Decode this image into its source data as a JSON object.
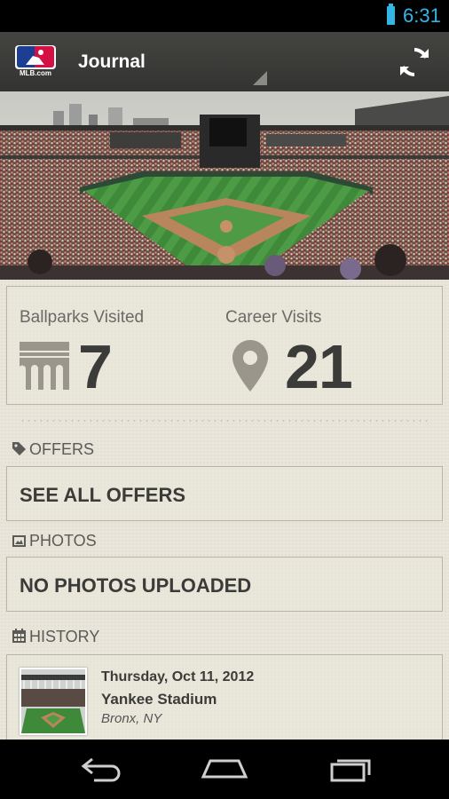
{
  "status_bar": {
    "time": "6:31"
  },
  "action_bar": {
    "logo_text": "MLB.com",
    "title": "Journal",
    "refresh_icon": "refresh-icon"
  },
  "stats": {
    "ballparks_label": "Ballparks Visited",
    "ballparks_value": "7",
    "career_label": "Career Visits",
    "career_value": "21"
  },
  "sections": {
    "offers": {
      "header": "OFFERS",
      "icon": "tag-icon",
      "card": "SEE ALL OFFERS"
    },
    "photos": {
      "header": "PHOTOS",
      "icon": "image-icon",
      "card": "NO PHOTOS UPLOADED"
    },
    "history": {
      "header": "HISTORY",
      "icon": "calendar-icon"
    }
  },
  "history_items": [
    {
      "date": "Thursday, Oct 11, 2012",
      "stadium": "Yankee Stadium",
      "city": "Bronx, NY"
    }
  ],
  "nav": {
    "back": "back-icon",
    "home": "home-icon",
    "recent": "recent-apps-icon"
  },
  "colors": {
    "accent": "#33b5e5",
    "action_bar": "#3a3a38",
    "paper": "#e9e5da",
    "text_dark": "#3b3b39"
  }
}
